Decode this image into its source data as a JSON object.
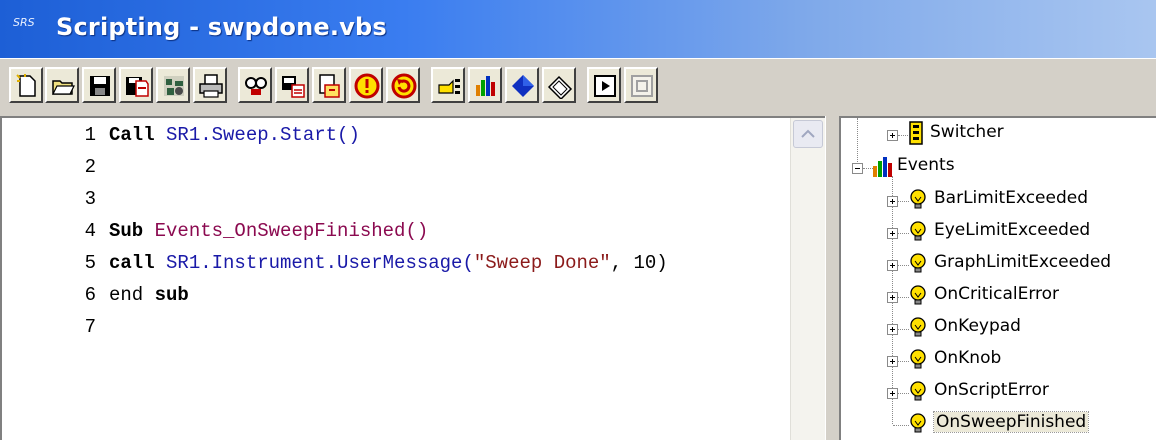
{
  "window": {
    "title": "Scripting - swpdone.vbs",
    "icon_text": "SRS"
  },
  "toolbar": {
    "buttons": [
      "new-icon",
      "open-icon",
      "save-icon",
      "save-as-icon",
      "run-icon",
      "print-icon",
      "find-icon",
      "load-icon",
      "load-file-icon",
      "stop-icon",
      "restart-icon",
      "pointer-icon",
      "chart-icon",
      "diamond-icon",
      "book-icon",
      "step-icon",
      "stop-square-icon"
    ]
  },
  "editor": {
    "lines": [
      {
        "n": "1"
      },
      {
        "n": "2"
      },
      {
        "n": "3"
      },
      {
        "n": "4"
      },
      {
        "n": "5"
      },
      {
        "n": "6"
      },
      {
        "n": "7"
      }
    ],
    "code": {
      "l1_kw": "Call",
      "l1_rest": " SR1.Sweep.Start()",
      "l4_kw": "Sub",
      "l4_rest": " Events_OnSweepFinished()",
      "l5_kw": "call",
      "l5_obj": " SR1.Instrument.UserMessage(",
      "l5_str": "\"Sweep Done\"",
      "l5_end": ", 10)",
      "l6_a": "end ",
      "l6_kw": "sub"
    }
  },
  "tree": {
    "switcher": "Switcher",
    "events": "Events",
    "items": [
      "BarLimitExceeded",
      "EyeLimitExceeded",
      "GraphLimitExceeded",
      "OnCriticalError",
      "OnKeypad",
      "OnKnob",
      "OnScriptError",
      "OnSweepFinished"
    ]
  }
}
